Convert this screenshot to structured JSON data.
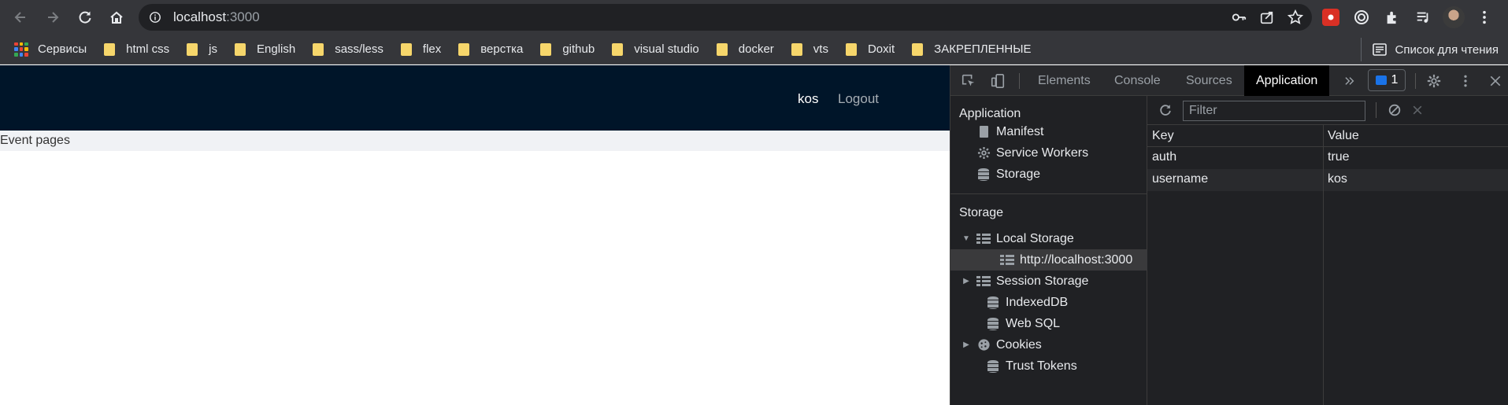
{
  "browser": {
    "url_host": "localhost",
    "url_port": ":3000",
    "bookmarks": [
      {
        "label": "Сервисы",
        "icon": "apps-grid-icon"
      },
      {
        "label": "html css",
        "icon": "folder-icon"
      },
      {
        "label": "js",
        "icon": "folder-icon"
      },
      {
        "label": "English",
        "icon": "folder-icon"
      },
      {
        "label": "sass/less",
        "icon": "folder-icon"
      },
      {
        "label": "flex",
        "icon": "folder-icon"
      },
      {
        "label": "верстка",
        "icon": "folder-icon"
      },
      {
        "label": "github",
        "icon": "folder-icon"
      },
      {
        "label": "visual studio",
        "icon": "folder-icon"
      },
      {
        "label": "docker",
        "icon": "folder-icon"
      },
      {
        "label": "vts",
        "icon": "folder-icon"
      },
      {
        "label": "Doxit",
        "icon": "folder-icon"
      },
      {
        "label": "ЗАКРЕПЛЕННЫЕ",
        "icon": "folder-icon"
      }
    ],
    "reading_list": "Список для чтения"
  },
  "app": {
    "header_user": "kos",
    "logout": "Logout",
    "content_text": "Event pages",
    "header_color": "#001529"
  },
  "devtools": {
    "tabs": [
      "Elements",
      "Console",
      "Sources",
      "Application"
    ],
    "active_tab": "Application",
    "issues_count": "1",
    "sidebar": {
      "application_heading": "Application",
      "application_items": [
        "Manifest",
        "Service Workers",
        "Storage"
      ],
      "storage_heading": "Storage",
      "local_storage": "Local Storage",
      "local_storage_origin": "http://localhost:3000",
      "session_storage": "Session Storage",
      "indexeddb": "IndexedDB",
      "websql": "Web SQL",
      "cookies": "Cookies",
      "trust_tokens": "Trust Tokens"
    },
    "filter_placeholder": "Filter",
    "table": {
      "columns": [
        "Key",
        "Value"
      ],
      "rows": [
        {
          "key": "auth",
          "value": "true"
        },
        {
          "key": "username",
          "value": "kos"
        }
      ]
    }
  }
}
